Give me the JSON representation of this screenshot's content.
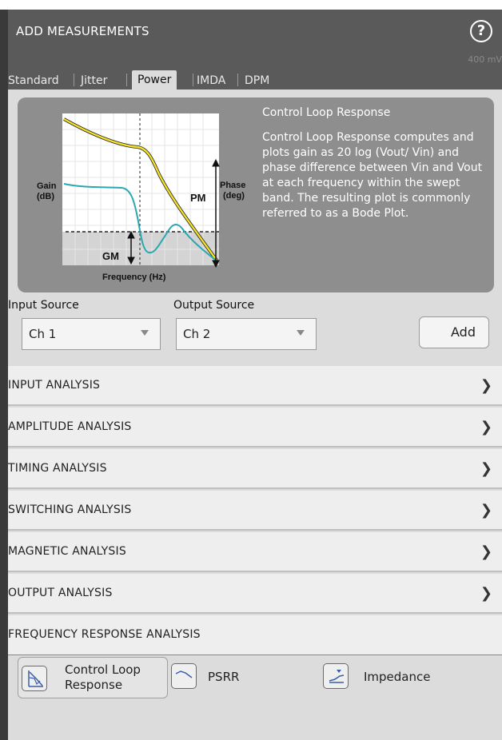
{
  "header": {
    "title": "ADD MEASUREMENTS",
    "help_icon": "question-circle-icon",
    "ghost_text": "400 mV"
  },
  "tabs": [
    {
      "label": "Standard",
      "active": false
    },
    {
      "label": "Jitter",
      "active": false
    },
    {
      "label": "Power",
      "active": true
    },
    {
      "label": "IMDA",
      "active": false
    },
    {
      "label": "DPM",
      "active": false
    }
  ],
  "info": {
    "title": "Control Loop Response",
    "description": "Control Loop Response computes and plots gain as 20 log (Vout/ Vin) and phase difference between Vin and Vout at each frequency within the swept band. The resulting plot is commonly referred to as a Bode Plot.",
    "diagram": {
      "gain_label_1": "Gain",
      "gain_label_2": "(dB)",
      "phase_label_1": "Phase",
      "phase_label_2": "(deg)",
      "pm_label": "PM",
      "gm_label": "GM",
      "x_label": "Frequency (Hz)"
    }
  },
  "sources": {
    "input_label": "Input Source",
    "input_value": "Ch 1",
    "output_label": "Output Source",
    "output_value": "Ch 2",
    "add_label": "Add"
  },
  "sections": [
    {
      "label": "INPUT ANALYSIS"
    },
    {
      "label": "AMPLITUDE ANALYSIS"
    },
    {
      "label": "TIMING ANALYSIS"
    },
    {
      "label": "SWITCHING ANALYSIS"
    },
    {
      "label": "MAGNETIC ANALYSIS"
    },
    {
      "label": "OUTPUT ANALYSIS"
    }
  ],
  "frequency_section": {
    "label": "FREQUENCY RESPONSE ANALYSIS",
    "items": [
      {
        "label_1": "Control Loop",
        "label_2": "Response",
        "icon": "control-loop-icon"
      },
      {
        "label": "PSRR",
        "icon": "psrr-icon"
      },
      {
        "label": "Impedance",
        "icon": "impedance-icon"
      }
    ]
  },
  "colors": {
    "header_bg": "#5a5a5a",
    "info_bg": "#8e8e8e",
    "gain_curve": "#f3e12c",
    "phase_curve": "#2aa8b0"
  }
}
